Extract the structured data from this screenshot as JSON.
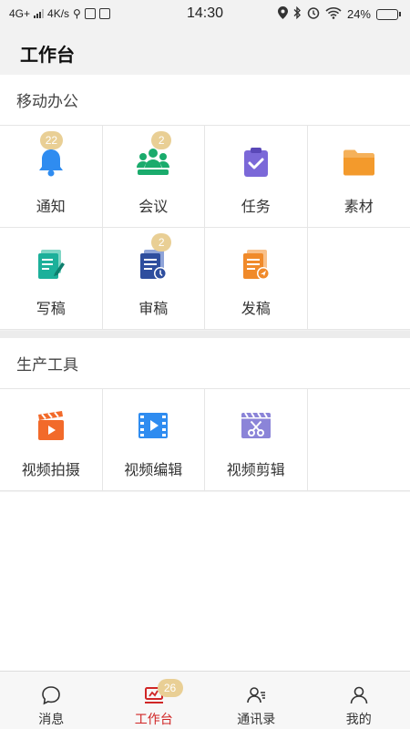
{
  "status_bar": {
    "network": "4G+",
    "speed": "4K/s",
    "time": "14:30",
    "battery": "24%",
    "battery_level": 0.24
  },
  "header": {
    "title": "工作台"
  },
  "mobile_office": {
    "title": "移动办公",
    "items": [
      {
        "label": "通知",
        "icon": "bell-icon",
        "badge": "22",
        "color": "#2f8cf0"
      },
      {
        "label": "会议",
        "icon": "meeting-group-icon",
        "badge": "2",
        "color": "#1aab6c"
      },
      {
        "label": "任务",
        "icon": "task-clipboard-icon",
        "badge": "",
        "color": "#7b68d8"
      },
      {
        "label": "素材",
        "icon": "folder-icon",
        "badge": "",
        "color": "#f39a2c"
      },
      {
        "label": "写稿",
        "icon": "write-doc-icon",
        "badge": "",
        "color": "#1cb09a"
      },
      {
        "label": "审稿",
        "icon": "review-doc-icon",
        "badge": "2",
        "color": "#2e4e9e"
      },
      {
        "label": "发稿",
        "icon": "send-doc-icon",
        "badge": "",
        "color": "#f08a2a"
      }
    ]
  },
  "production_tools": {
    "title": "生产工具",
    "items": [
      {
        "label": "视频拍摄",
        "icon": "video-shoot-icon",
        "color": "#f26a2a"
      },
      {
        "label": "视频编辑",
        "icon": "video-edit-icon",
        "color": "#2f8cf0"
      },
      {
        "label": "视频剪辑",
        "icon": "video-cut-icon",
        "color": "#8b84d8"
      }
    ]
  },
  "bottom_nav": {
    "items": [
      {
        "label": "消息",
        "icon": "chat-bubble-icon",
        "active": false
      },
      {
        "label": "工作台",
        "icon": "workbench-icon",
        "active": true,
        "badge": "26"
      },
      {
        "label": "通讯录",
        "icon": "contacts-icon",
        "active": false
      },
      {
        "label": "我的",
        "icon": "profile-icon",
        "active": false
      }
    ],
    "active_color": "#d02626"
  }
}
